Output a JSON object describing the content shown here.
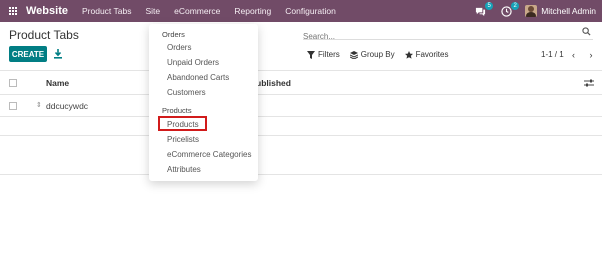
{
  "navbar": {
    "brand": "Website",
    "menu": [
      "Product Tabs",
      "Site",
      "eCommerce",
      "Reporting",
      "Configuration"
    ],
    "chat_count": "5",
    "activity_count": "2",
    "user_name": "Mitchell Admin",
    "bg_color": "#714b67"
  },
  "control": {
    "title": "Product Tabs",
    "create_label": "CREATE",
    "search_placeholder": "Search...",
    "filters_label": "Filters",
    "group_by_label": "Group By",
    "favorites_label": "Favorites",
    "pager": "1-1 / 1",
    "pager_arrows": "‹ ›",
    "accent_color": "#017e84"
  },
  "list": {
    "col_name": "Name",
    "col_published": "ublished",
    "rows": [
      {
        "name": "ddcucywdc"
      }
    ]
  },
  "dropdown": {
    "section_orders": "Orders",
    "orders_items": [
      "Orders",
      "Unpaid Orders",
      "Abandoned Carts",
      "Customers"
    ],
    "section_products": "Products",
    "products_items": [
      "Products",
      "Pricelists",
      "eCommerce Categories",
      "Attributes"
    ],
    "highlight_color": "#d11b1b"
  }
}
